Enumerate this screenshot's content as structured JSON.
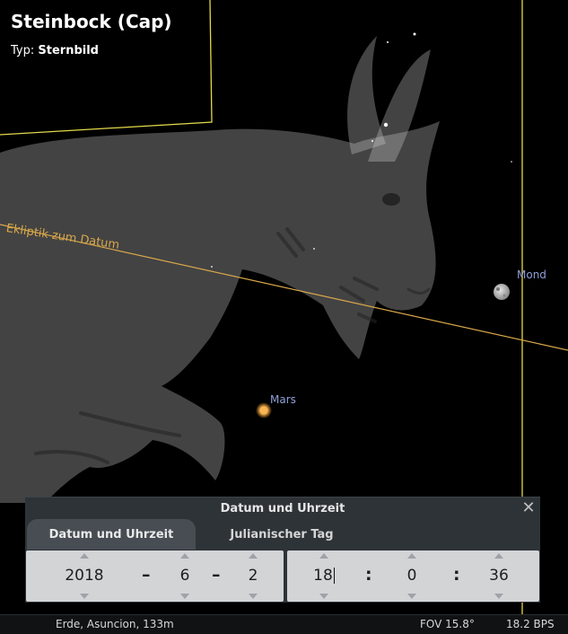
{
  "info": {
    "title": "Steinbock (Cap)",
    "type_label": "Typ:",
    "type_value": "Sternbild"
  },
  "sky": {
    "ecliptic_label": "Ekliptik zum Datum",
    "moon_label": "Mond",
    "mars_label": "Mars",
    "colors": {
      "ecliptic": "#d9a74a",
      "boundary": "#e3d84a",
      "planet_label": "#8f9fd8",
      "constellation_art": "#cfcfcf"
    }
  },
  "dialog": {
    "title": "Datum und Uhrzeit",
    "close_icon": "close-icon",
    "tabs": [
      {
        "label": "Datum und Uhrzeit",
        "active": true
      },
      {
        "label": "Julianischer Tag",
        "active": false
      }
    ],
    "date": {
      "year": "2018",
      "month": "6",
      "day": "2",
      "separator": "–"
    },
    "time": {
      "hour": "18",
      "minute": "0",
      "second": "36",
      "separator": ":"
    }
  },
  "statusbar": {
    "location": "Erde, Asuncion, 133m",
    "fov": "FOV 15.8°",
    "fps": "18.2 BPS"
  }
}
